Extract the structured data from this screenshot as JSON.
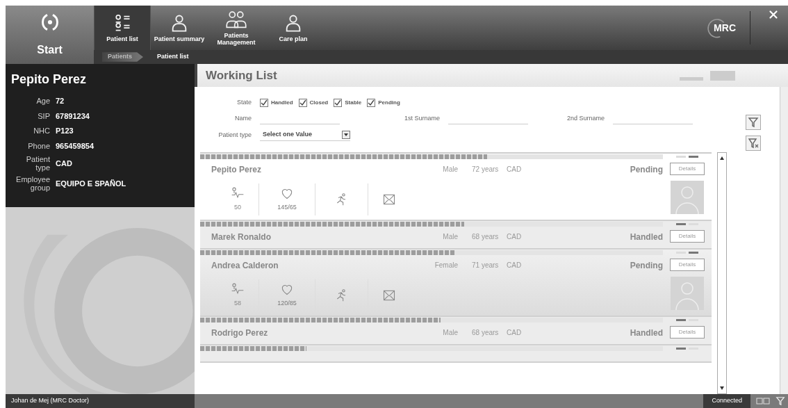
{
  "header": {
    "start_label": "Start",
    "logo_text": "MRC",
    "tabs": [
      {
        "label": "Patient list",
        "kind": "list",
        "selected": true
      },
      {
        "label": "Patient summary",
        "kind": "person",
        "selected": false
      },
      {
        "label": "Patients Management",
        "kind": "people",
        "selected": false
      },
      {
        "label": "Care plan",
        "kind": "person",
        "selected": false
      }
    ],
    "breadcrumb": [
      {
        "label": "Patients",
        "current": false
      },
      {
        "label": "Patient list",
        "current": true
      }
    ]
  },
  "patient_panel": {
    "name": "Pepito Perez",
    "fields": [
      {
        "label": "Age",
        "value": "72"
      },
      {
        "label": "SIP",
        "value": "67891234"
      },
      {
        "label": "NHC",
        "value": "P123"
      },
      {
        "label": "Phone",
        "value": "965459854"
      },
      {
        "label": "Patient type",
        "value": "CAD"
      },
      {
        "label": "Employee group",
        "value": "EQUIPO E SPAÑOL"
      }
    ]
  },
  "working_list": {
    "title": "Working List",
    "filters": {
      "state_label": "State",
      "states": [
        {
          "label": "Handled",
          "checked": true
        },
        {
          "label": "Closed",
          "checked": true
        },
        {
          "label": "Stable",
          "checked": true
        },
        {
          "label": "Pending",
          "checked": true
        }
      ],
      "name_label": "Name",
      "surname1_label": "1st Surname",
      "surname2_label": "2nd Surname",
      "patient_type_label": "Patient type",
      "patient_type_value": "Select one Value"
    },
    "patients": [
      {
        "name": "Pepito Perez",
        "gender": "Male",
        "age": "72 years",
        "type": "CAD",
        "state": "Pending",
        "details": "Details",
        "level": 0.62,
        "expanded": true,
        "selected": true,
        "pulse": "50",
        "pressure": "145/65"
      },
      {
        "name": "Marek Ronaldo",
        "gender": "Male",
        "age": "68 years",
        "type": "CAD",
        "state": "Handled",
        "details": "Details",
        "level": 0.57,
        "expanded": false,
        "selected": false
      },
      {
        "name": "Andrea Calderon",
        "gender": "Female",
        "age": "71 years",
        "type": "CAD",
        "state": "Pending",
        "details": "Details",
        "level": 0.55,
        "expanded": true,
        "selected": false,
        "pulse": "58",
        "pressure": "120/85"
      },
      {
        "name": "Rodrigo Perez",
        "gender": "Male",
        "age": "68 years",
        "type": "CAD",
        "state": "Handled",
        "details": "Details",
        "level": 0.52,
        "expanded": false,
        "selected": false
      },
      {
        "kind": "partial",
        "level": 0.23,
        "expanded": false,
        "selected": false
      }
    ]
  },
  "status_bar": {
    "user": "Johan de Mej (MRC Doctor)",
    "connection": "Connected"
  }
}
